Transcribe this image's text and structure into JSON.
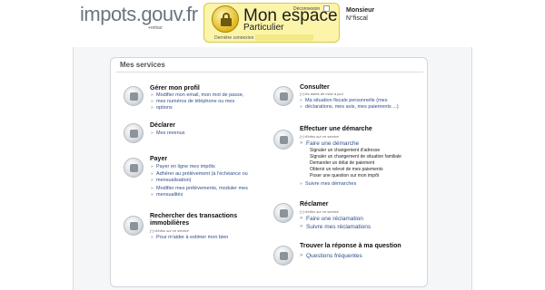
{
  "header": {
    "logo": "impots.gouv.fr",
    "logo_sub": "+retour",
    "space_title": "Mon espace",
    "space_subtitle": "Particulier",
    "deconnexion": "Déconnexion",
    "last_connection_label": "Dernière connexion :",
    "user_name": "Monsieur",
    "user_fiscal": "N°fiscal"
  },
  "services": {
    "title": "Mes services",
    "gerer": {
      "title": "Gérer mon profil",
      "links": [
        "Modifier mon email, mon mot de passe,",
        "mes numéros de téléphone ou mes",
        "options"
      ]
    },
    "declarer": {
      "title": "Déclarer",
      "links": [
        "Mes revenus"
      ]
    },
    "payer": {
      "title": "Payer",
      "links": [
        "Payer en ligne mes impôts",
        "Adhérer au prélèvement (à l'échéance ou",
        "mensualisation)",
        "Modifier mes prélèvements, moduler mes",
        "mensualités"
      ]
    },
    "transactions": {
      "title_line1": "Rechercher des transactions",
      "title_line2": "immobilières",
      "note": "[+] d'infos sur ce service",
      "links": [
        "Pour m'aider à estimer mon bien"
      ]
    },
    "consulter": {
      "title": "Consulter",
      "note": "[+] les dates de mise à jour",
      "links": [
        "Ma situation fiscale personnelle (mes",
        "déclarations, mes avis, mes paiements ...)"
      ]
    },
    "demarche": {
      "title": "Effectuer une démarche",
      "note": "[+] d'infos sur ce service",
      "main_link": "Faire une démarche",
      "items": [
        "Signaler un changement d'adresse",
        "Signaler un changement de situation familiale",
        "Demander un délai de paiement",
        "Obtenir un relevé de mes paiements",
        "Poser une question sur mon impôt"
      ],
      "follow_link": "Suivre mes démarches"
    },
    "reclamer": {
      "title": "Réclamer",
      "note": "[+] d'infos sur ce service",
      "links": [
        "Faire une réclamation",
        "Suivre mes réclamations"
      ]
    },
    "question": {
      "title": "Trouver la réponse à ma question",
      "links": [
        "Questions fréquentes"
      ]
    }
  }
}
